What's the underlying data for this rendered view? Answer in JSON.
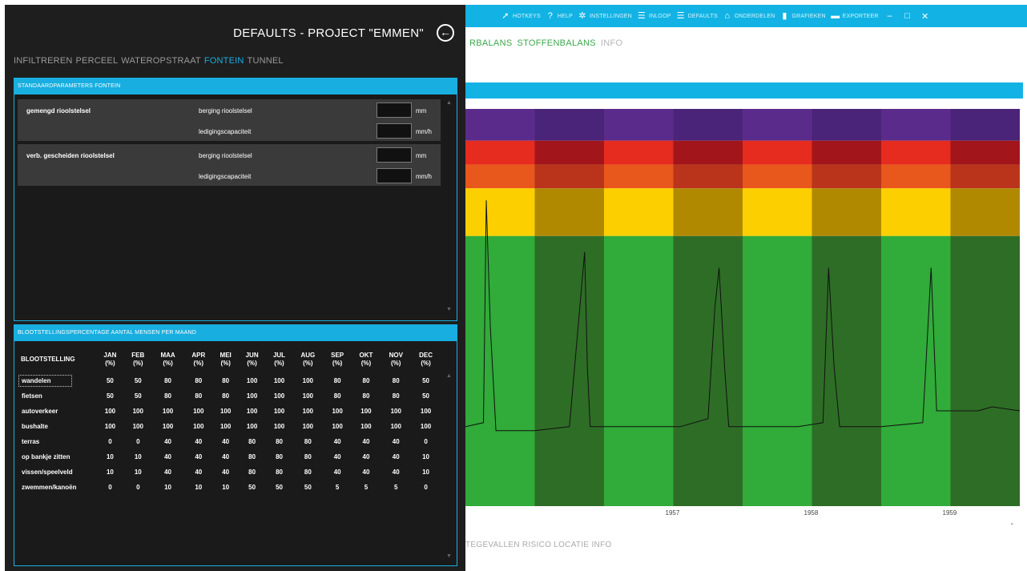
{
  "toolbar": {
    "items": [
      {
        "label": "HOTKEYS",
        "icon": "cursor-key-icon"
      },
      {
        "label": "HELP",
        "icon": "help-icon"
      },
      {
        "label": "INSTELLINGEN",
        "icon": "gear-icon"
      },
      {
        "label": "INLOOP",
        "icon": "list-icon"
      },
      {
        "label": "DEFAULTS",
        "icon": "list-icon"
      },
      {
        "label": "ONDERDELEN",
        "icon": "home-icon"
      },
      {
        "label": "GRAFIEKEN",
        "icon": "bar-chart-icon"
      },
      {
        "label": "EXPORTEER",
        "icon": "save-icon"
      }
    ],
    "minimize": "–",
    "maximize": "□",
    "close": "✕"
  },
  "bg_tabs": {
    "tab1": "RBALANS",
    "tab2": "STOFFENBALANS",
    "tab3": "INFO"
  },
  "bottom_tabs": "TEGEVALLEN  RISICO  LOCATIE  INFO",
  "chart_data": {
    "type": "line",
    "x_ticks": [
      "1957",
      "1958",
      "1959"
    ],
    "bands": {
      "colors_light": [
        "#5b2b8c",
        "#e62b1f",
        "#e8581c",
        "#fcd000",
        "#31ab39"
      ],
      "colors_dark": [
        "#4a2478",
        "#a2161b",
        "#b9341a",
        "#b08900",
        "#2e6d26"
      ],
      "thresholds": [
        1.0,
        0.92,
        0.86,
        0.8,
        0.68
      ]
    },
    "series": [
      {
        "color": "#111111",
        "x": [
          1956.0,
          1956.13,
          1956.15,
          1956.18,
          1956.22,
          1956.5,
          1956.75,
          1956.82,
          1956.86,
          1956.88,
          1956.9,
          1957.0,
          1957.3,
          1957.55,
          1957.75,
          1957.8,
          1957.83,
          1957.87,
          1957.9,
          1958.0,
          1958.4,
          1958.58,
          1958.62,
          1958.66,
          1958.7,
          1959.0,
          1959.3,
          1959.36,
          1959.4,
          1959.5,
          1959.7,
          1959.8,
          1960.0
        ],
        "y": [
          0.2,
          0.21,
          0.77,
          0.45,
          0.19,
          0.19,
          0.2,
          0.48,
          0.64,
          0.35,
          0.2,
          0.2,
          0.2,
          0.2,
          0.22,
          0.5,
          0.6,
          0.35,
          0.2,
          0.2,
          0.2,
          0.21,
          0.6,
          0.35,
          0.2,
          0.2,
          0.21,
          0.6,
          0.24,
          0.24,
          0.24,
          0.25,
          0.24
        ]
      }
    ]
  },
  "dialog": {
    "title": "DEFAULTS - PROJECT \"EMMEN\"",
    "back_icon": "arrow-left-circle-icon",
    "tabs": [
      "INFILTREREN",
      "PERCEEL",
      "WATEROPSTRAAT",
      "FONTEIN",
      "TUNNEL"
    ],
    "active_tab": "FONTEIN",
    "panel1": {
      "header": "STANDAARDPARAMETERS FONTEIN",
      "groups": [
        {
          "label": "gemengd rioolstelsel",
          "rows": [
            {
              "label": "berging rioolstelsel",
              "value": "",
              "unit": "mm"
            },
            {
              "label": "ledigingscapaciteit",
              "value": "",
              "unit": "mm/h"
            }
          ]
        },
        {
          "label": "verb. gescheiden rioolstelsel",
          "rows": [
            {
              "label": "berging rioolstelsel",
              "value": "",
              "unit": "mm"
            },
            {
              "label": "ledigingscapaciteit",
              "value": "",
              "unit": "mm/h"
            }
          ]
        }
      ]
    },
    "panel2": {
      "header": "BLOOTSTELLINGSPERCENTAGE AANTAL MENSEN PER MAAND",
      "first_col": "BLOOTSTELLING",
      "months": [
        "JAN",
        "FEB",
        "MAA",
        "APR",
        "MEI",
        "JUN",
        "JUL",
        "AUG",
        "SEP",
        "OKT",
        "NOV",
        "DEC"
      ],
      "unit": "(%)",
      "rows": [
        {
          "name": "wandelen",
          "values": [
            "50",
            "50",
            "80",
            "80",
            "80",
            "100",
            "100",
            "100",
            "80",
            "80",
            "80",
            "50"
          ]
        },
        {
          "name": "fietsen",
          "values": [
            "50",
            "50",
            "80",
            "80",
            "80",
            "100",
            "100",
            "100",
            "80",
            "80",
            "80",
            "50"
          ]
        },
        {
          "name": "autoverkeer",
          "values": [
            "100",
            "100",
            "100",
            "100",
            "100",
            "100",
            "100",
            "100",
            "100",
            "100",
            "100",
            "100"
          ]
        },
        {
          "name": "bushalte",
          "values": [
            "100",
            "100",
            "100",
            "100",
            "100",
            "100",
            "100",
            "100",
            "100",
            "100",
            "100",
            "100"
          ]
        },
        {
          "name": "terras",
          "values": [
            "0",
            "0",
            "40",
            "40",
            "40",
            "80",
            "80",
            "80",
            "40",
            "40",
            "40",
            "0"
          ]
        },
        {
          "name": "op bankje zitten",
          "values": [
            "10",
            "10",
            "40",
            "40",
            "40",
            "80",
            "80",
            "80",
            "40",
            "40",
            "40",
            "10"
          ]
        },
        {
          "name": "vissen/speelveld",
          "values": [
            "10",
            "10",
            "40",
            "40",
            "40",
            "80",
            "80",
            "80",
            "40",
            "40",
            "40",
            "10"
          ]
        },
        {
          "name": "zwemmen/kanoën",
          "values": [
            "0",
            "0",
            "10",
            "10",
            "10",
            "50",
            "50",
            "50",
            "5",
            "5",
            "5",
            "0"
          ]
        }
      ]
    }
  }
}
